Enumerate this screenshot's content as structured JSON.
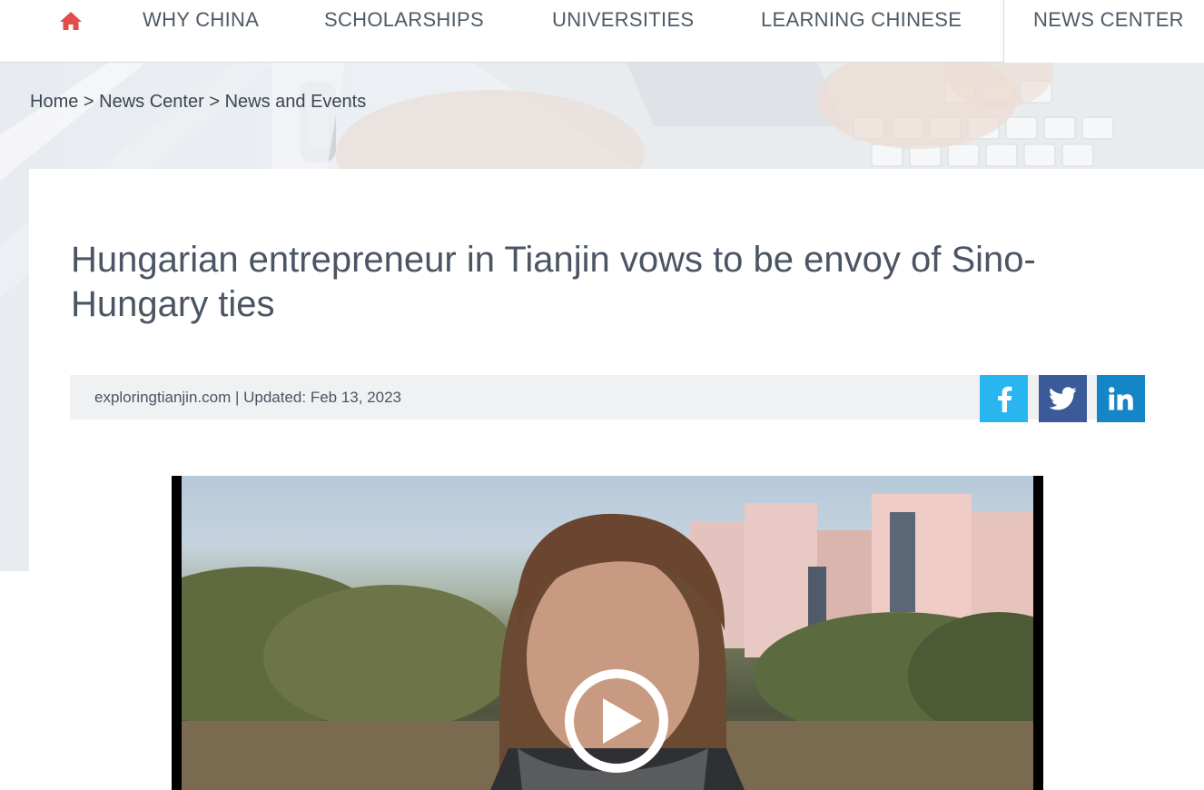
{
  "nav": {
    "home_icon": "home-icon",
    "home_color": "#e44b4b",
    "items": [
      {
        "label": "WHY CHINA"
      },
      {
        "label": "SCHOLARSHIPS"
      },
      {
        "label": "UNIVERSITIES"
      },
      {
        "label": "LEARNING CHINESE"
      },
      {
        "label": "NEWS CENTER"
      }
    ],
    "active": "NEWS CENTER"
  },
  "breadcrumb": {
    "items": [
      "Home",
      "News Center",
      "News and Events"
    ],
    "separator": ">"
  },
  "article": {
    "title": "Hungarian entrepreneur in Tianjin vows to be envoy of Sino-Hungary ties",
    "meta": "exploringtianjin.com | Updated: Feb 13, 2023"
  },
  "share": {
    "facebook": {
      "icon": "facebook-icon",
      "color": "#29b6f0"
    },
    "twitter": {
      "icon": "twitter-icon",
      "color": "#3b5a99"
    },
    "linkedin": {
      "icon": "linkedin-icon",
      "color": "#1485c6"
    }
  },
  "video": {
    "play_icon": "play-icon"
  }
}
